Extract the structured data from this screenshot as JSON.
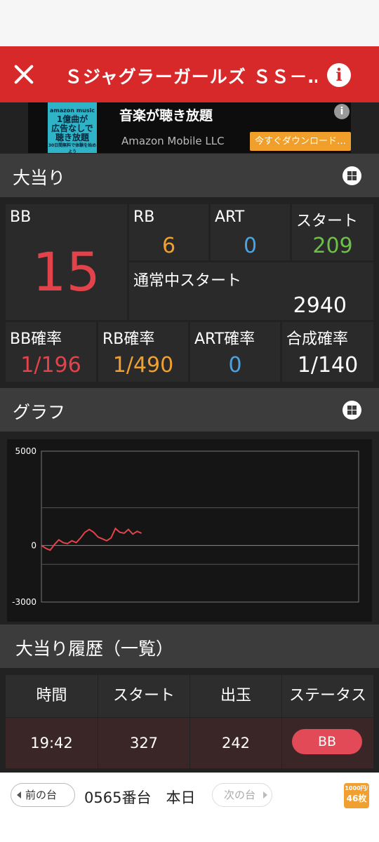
{
  "header": {
    "title": "Ｓジャグラーガールズ ＳＳ－…",
    "info_label": "i"
  },
  "ad": {
    "thumb_brand": "amazon music",
    "thumb_line1": "1億曲が",
    "thumb_line2": "広告なしで",
    "thumb_line3": "聴き放題",
    "thumb_line4": "30日間無料で体験を始めよう",
    "title": "音楽が聴き放題",
    "advertiser": "Amazon Mobile LLC",
    "cta": "今すぐダウンロード…",
    "info": "i"
  },
  "jackpot": {
    "section_title": "大当り",
    "bb_label": "BB",
    "bb_value": "15",
    "rb_label": "RB",
    "rb_value": "6",
    "art_label": "ART",
    "art_value": "0",
    "start_label": "スタート",
    "start_value": "209",
    "normal_start_label": "通常中スタート",
    "normal_start_value": "2940",
    "bb_rate_label": "BB確率",
    "bb_rate_value": "1/196",
    "rb_rate_label": "RB確率",
    "rb_rate_value": "1/490",
    "art_rate_label": "ART確率",
    "art_rate_value": "0",
    "combined_rate_label": "合成確率",
    "combined_rate_value": "1/140"
  },
  "graph": {
    "section_title": "グラフ"
  },
  "chart_data": {
    "type": "line",
    "ylim": [
      -3000,
      5000
    ],
    "yticks": [
      "5000",
      "0",
      "-3000"
    ],
    "gridlines": [
      5000,
      2000,
      0,
      -1000,
      -3000
    ],
    "series": [
      {
        "color": "#e2434b",
        "x": [
          0,
          1,
          2,
          3,
          4,
          5,
          6,
          7,
          8,
          9,
          10,
          11,
          12,
          13,
          14,
          15,
          16,
          17,
          18,
          19,
          20,
          21,
          22,
          23
        ],
        "values": [
          0,
          -150,
          -250,
          50,
          300,
          150,
          100,
          250,
          150,
          400,
          700,
          850,
          700,
          450,
          350,
          250,
          400,
          900,
          700,
          650,
          850,
          600,
          750,
          650
        ]
      }
    ]
  },
  "history": {
    "section_title": "大当り履歴（一覧）",
    "columns": [
      "時間",
      "スタート",
      "出玉",
      "ステータス"
    ],
    "rows": [
      {
        "time": "19:42",
        "start": "327",
        "payout": "242",
        "status": "BB"
      }
    ]
  },
  "bottom": {
    "prev_label": "前の台",
    "title": "0565番台　本日",
    "next_label": "次の台",
    "badge_top": "1000円/",
    "badge_bottom": "46枚"
  },
  "colors": {
    "header_red": "#d7282a",
    "bb_red": "#e2434b",
    "rb_orange": "#f0a030",
    "art_blue": "#4aa3e0",
    "start_green": "#6cc04a"
  }
}
